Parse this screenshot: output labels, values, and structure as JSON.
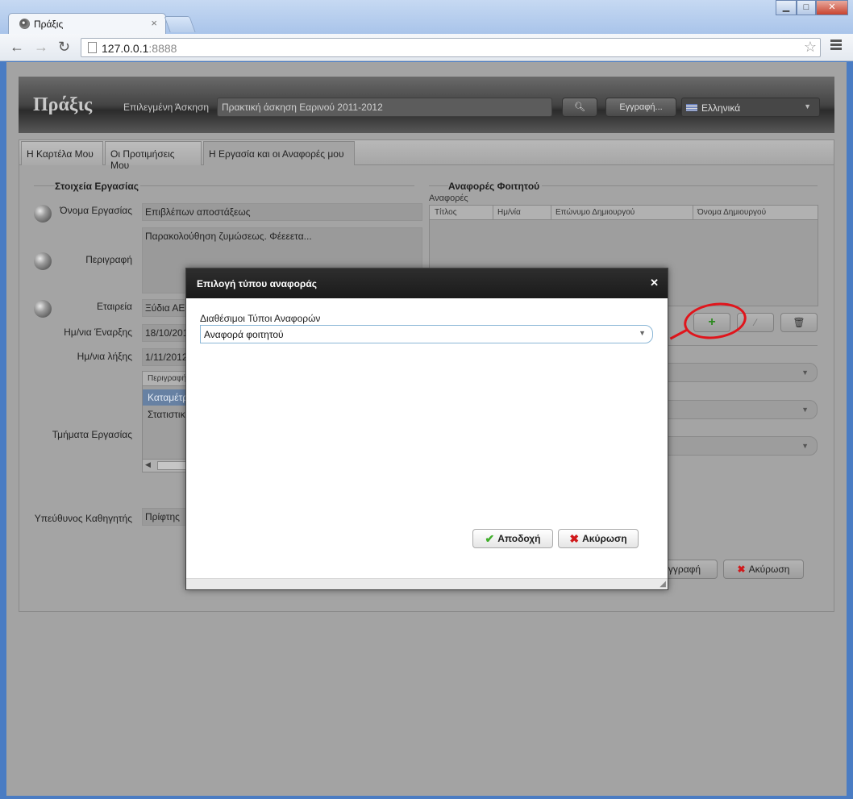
{
  "browser": {
    "tab_title": "Πράξις",
    "url_host": "127.0.0.1",
    "url_port": ":8888"
  },
  "app": {
    "logo": "Πράξις",
    "selected_exercise_label": "Επιλεγμένη Άσκηση",
    "selected_exercise_value": "Πρακτική άσκηση Εαρινού 2011-2012",
    "register_button": "Εγγραφή...",
    "language": "Ελληνικά"
  },
  "tabs": [
    "Η Καρτέλα Μου",
    "Οι Προτιμήσεις Μου",
    "Η Εργασία και οι Αναφορές μου"
  ],
  "work": {
    "section_title": "Στοιχεία Εργασίας",
    "name_label": "Όνομα Εργασίας",
    "name_value": "Επιβλέπων αποστάξεως",
    "description_label": "Περιγραφή",
    "description_value": "Παρακολούθηση ζυμώσεως. Φέεεετα...",
    "company_label": "Εταιρεία",
    "company_value": "Ξύδια ΑΕ",
    "start_label": "Ημ/νια Έναρξης",
    "start_value": "18/10/2011",
    "end_label": "Ημ/νια λήξης",
    "end_value": "1/11/2012",
    "parts_label": "Τμήματα Εργασίας",
    "parts_header": "Περιγραφή",
    "parts_rows": [
      "Καταμέτρηση",
      "Στατιστικά"
    ],
    "supervisor_label": "Υπεύθυνος Καθηγητής",
    "supervisor_value": "Πρίφτης"
  },
  "reports": {
    "section_title": "Αναφορές Φοιτητού",
    "grid_label": "Αναφορές",
    "columns": [
      "Τίτλος",
      "Ημ/νία",
      "Επώνυμο Δημιουργού",
      "Όνομα Δημιουργού"
    ]
  },
  "form_buttons": {
    "save": "Εγγραφή",
    "cancel": "Ακύρωση"
  },
  "modal": {
    "title": "Επιλογή τύπου αναφοράς",
    "field_label": "Διαθέσιμοι Τύποι Αναφορών",
    "field_value": "Αναφορά φοιτητού",
    "accept": "Αποδοχή",
    "cancel": "Ακύρωση"
  },
  "colors": {
    "annotation_circle": "#e0151c",
    "accept_icon": "#3fae2a",
    "cancel_icon": "#d0191b"
  },
  "icons": [
    "globe-icon",
    "search-icon",
    "add-icon",
    "edit-icon",
    "trash-icon",
    "check-icon",
    "cross-icon",
    "close-icon",
    "star-icon"
  ]
}
